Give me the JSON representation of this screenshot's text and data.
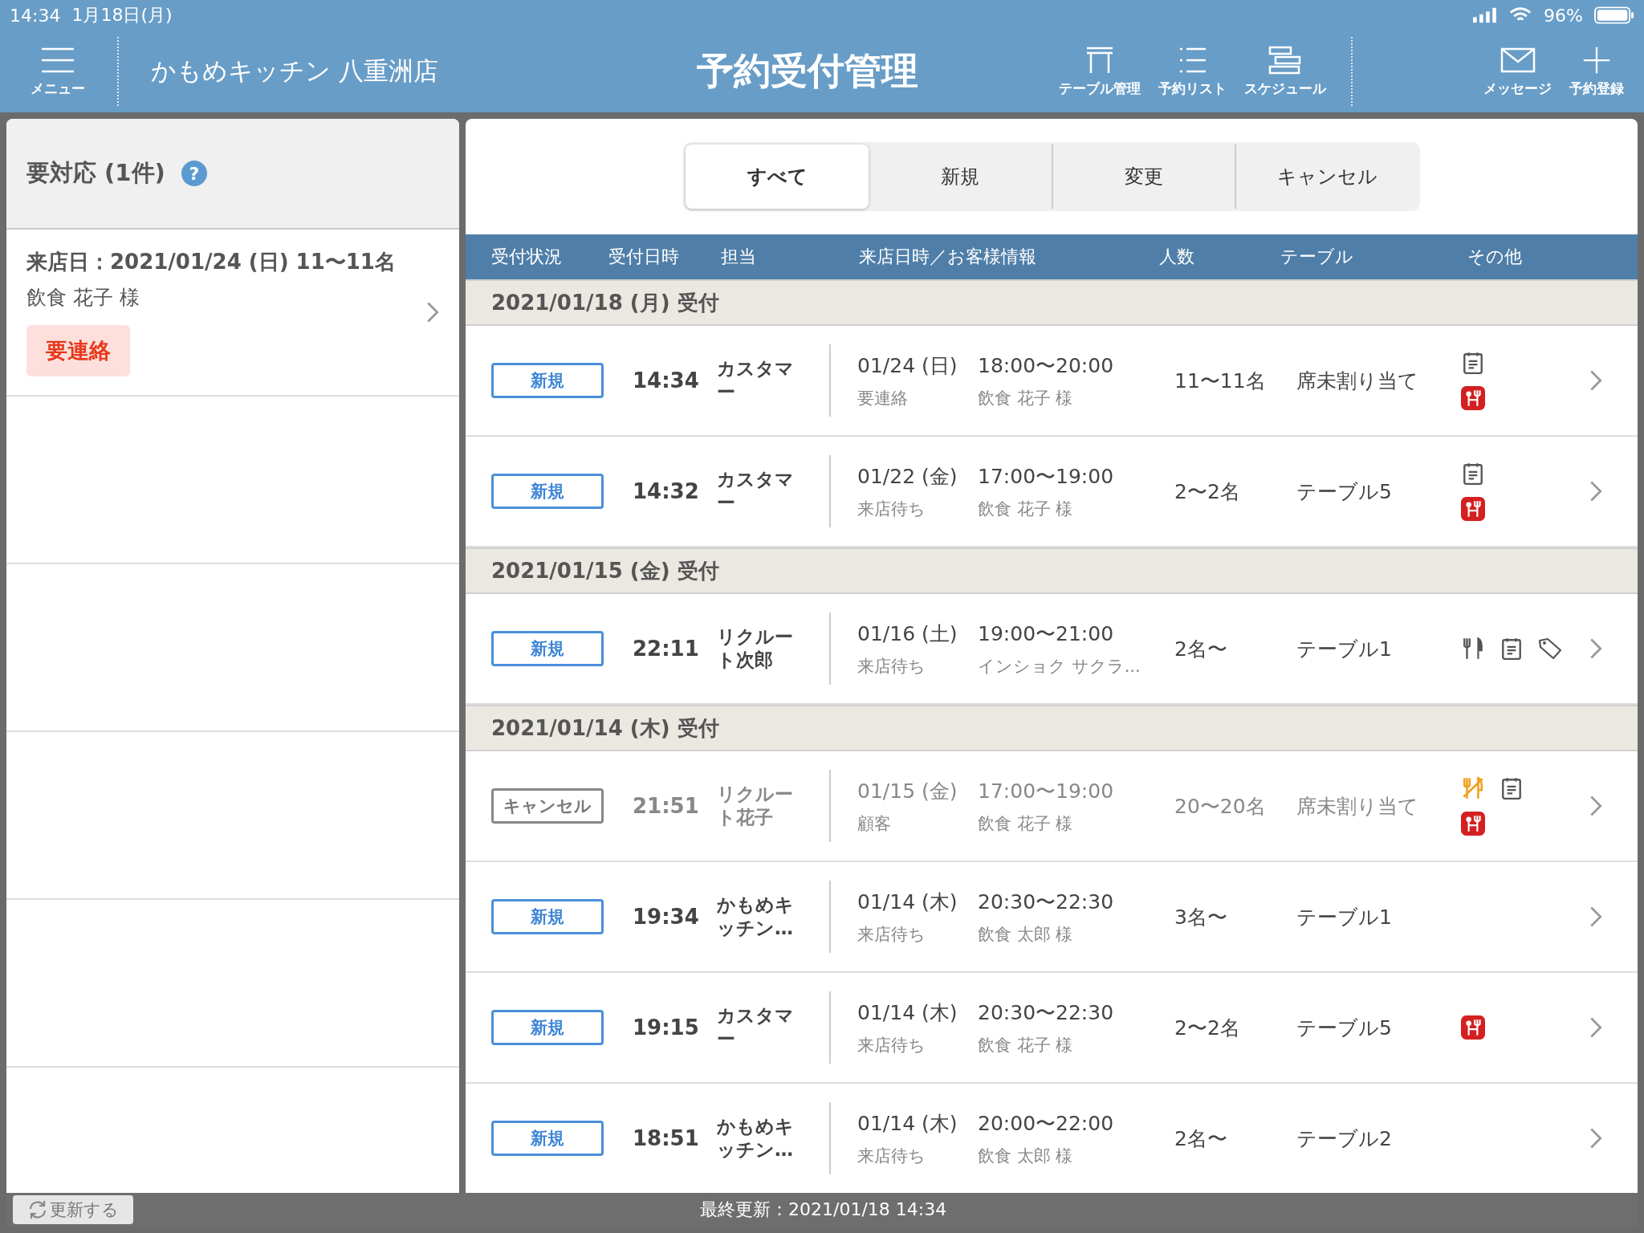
{
  "status_bar": {
    "time": "14:34",
    "date": "1月18日(月)",
    "battery": "96%"
  },
  "header": {
    "menu_label": "メニュー",
    "store": "かもめキッチン 八重洲店",
    "title": "予約受付管理",
    "tools": [
      {
        "kind": "table",
        "label": "テーブル管理"
      },
      {
        "kind": "list",
        "label": "予約リスト"
      },
      {
        "kind": "schedule",
        "label": "スケジュール"
      }
    ],
    "actions": [
      {
        "kind": "message",
        "label": "メッセージ"
      },
      {
        "kind": "add",
        "label": "予約登録"
      }
    ]
  },
  "sidebar": {
    "title": "要対応 (1件)",
    "help": "?",
    "items": [
      {
        "visit": "来店日：2021/01/24 (日) 11〜11名",
        "customer": "飲食 花子 様",
        "tag": "要連絡"
      }
    ]
  },
  "tabs": [
    {
      "label": "すべて",
      "selected": true
    },
    {
      "label": "新規",
      "selected": false
    },
    {
      "label": "変更",
      "selected": false
    },
    {
      "label": "キャンセル",
      "selected": false
    }
  ],
  "table": {
    "columns": [
      "受付状況",
      "受付日時",
      "担当",
      "来店日時／お客様情報",
      "人数",
      "テーブル",
      "その他"
    ],
    "groups": [
      {
        "date": "2021/01/18 (月) 受付",
        "rows": [
          {
            "status": "新規",
            "kind": "new",
            "time": "14:34",
            "staff": "カスタマー",
            "visit_date": "01/24 (日)",
            "visit_time": "18:00〜20:00",
            "state": "要連絡",
            "customer": "飲食 花子 様",
            "people": "11〜11名",
            "table": "席未割り当て",
            "icons": [
              {
                "kind": "memo"
              },
              {
                "kind": "course"
              }
            ]
          },
          {
            "status": "新規",
            "kind": "new",
            "time": "14:32",
            "staff": "カスタマー",
            "visit_date": "01/22 (金)",
            "visit_time": "17:00〜19:00",
            "state": "来店待ち",
            "customer": "飲食 花子 様",
            "people": "2〜2名",
            "table": "テーブル5",
            "icons": [
              {
                "kind": "memo"
              },
              {
                "kind": "course"
              }
            ]
          }
        ]
      },
      {
        "date": "2021/01/15 (金) 受付",
        "rows": [
          {
            "status": "新規",
            "kind": "new",
            "time": "22:11",
            "staff": "リクルート次郎",
            "visit_date": "01/16 (土)",
            "visit_time": "19:00〜21:00",
            "state": "来店待ち",
            "customer": "インショク サクラ...",
            "people": "2名〜",
            "table": "テーブル1",
            "icons": [
              {
                "kind": "cutlery"
              },
              {
                "kind": "memo"
              },
              {
                "kind": "tag"
              }
            ]
          }
        ]
      },
      {
        "date": "2021/01/14 (木) 受付",
        "rows": [
          {
            "status": "キャンセル",
            "kind": "cancel",
            "time": "21:51",
            "staff": "リクルート花子",
            "visit_date": "01/15 (金)",
            "visit_time": "17:00〜19:00",
            "state": "顧客",
            "customer": "飲食 花子 様",
            "people": "20〜20名",
            "table": "席未割り当て",
            "icons": [
              {
                "kind": "no-cutlery"
              },
              {
                "kind": "memo"
              },
              {
                "kind": "course"
              }
            ]
          },
          {
            "status": "新規",
            "kind": "new",
            "time": "19:34",
            "staff": "かもめキッチン…",
            "visit_date": "01/14 (木)",
            "visit_time": "20:30〜22:30",
            "state": "来店待ち",
            "customer": "飲食 太郎 様",
            "people": "3名〜",
            "table": "テーブル1",
            "icons": []
          },
          {
            "status": "新規",
            "kind": "new",
            "time": "19:15",
            "staff": "カスタマー",
            "visit_date": "01/14 (木)",
            "visit_time": "20:30〜22:30",
            "state": "来店待ち",
            "customer": "飲食 花子 様",
            "people": "2〜2名",
            "table": "テーブル5",
            "icons": [
              {
                "kind": "course"
              }
            ]
          },
          {
            "status": "新規",
            "kind": "new",
            "time": "18:51",
            "staff": "かもめキッチン…",
            "visit_date": "01/14 (木)",
            "visit_time": "20:00〜22:00",
            "state": "来店待ち",
            "customer": "飲食 太郎 様",
            "people": "2名〜",
            "table": "テーブル2",
            "icons": []
          }
        ]
      }
    ]
  },
  "footer": {
    "refresh": "更新する",
    "updated": "最終更新：2021/01/18 14:34"
  }
}
